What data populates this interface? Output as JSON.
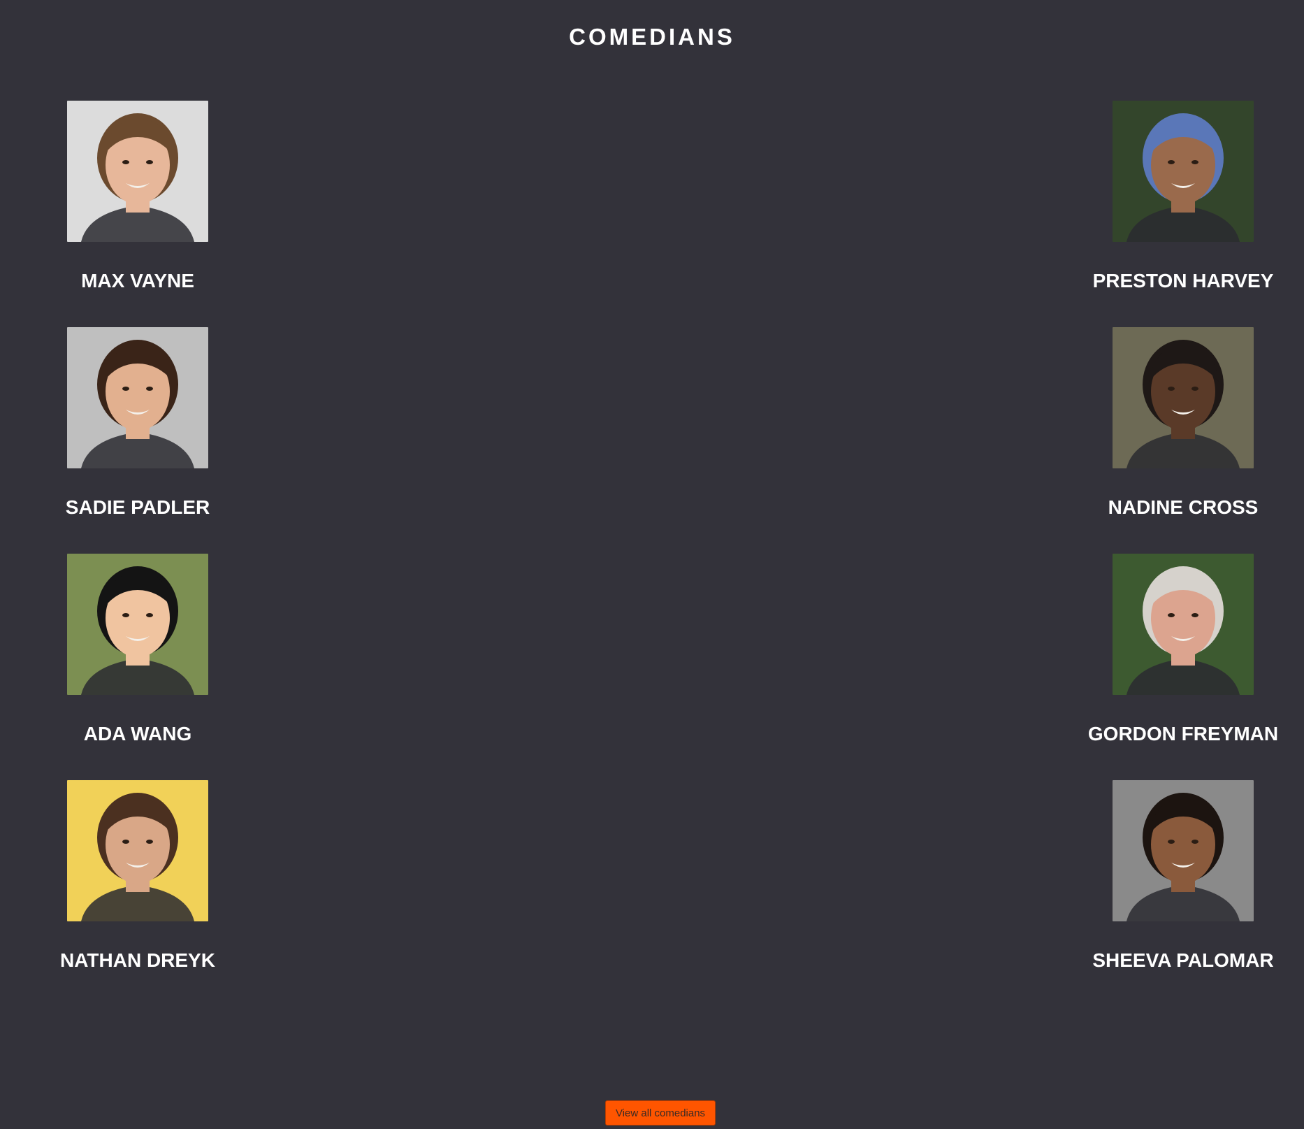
{
  "page": {
    "title": "COMEDIANS",
    "background": "#33323a"
  },
  "comedians_left": [
    {
      "name": "MAX VAYNE",
      "photo": "portrait-photo",
      "bg": "#dcdcdc",
      "skin": "#e7b79a",
      "hair": "#6b4a2e"
    },
    {
      "name": "SADIE PADLER",
      "photo": "portrait-photo",
      "bg": "#bfbfbf",
      "skin": "#e2b08f",
      "hair": "#3a2418"
    },
    {
      "name": "ADA WANG",
      "photo": "portrait-photo",
      "bg": "#7c8f52",
      "skin": "#f0c4a0",
      "hair": "#141414"
    },
    {
      "name": "NATHAN DREYK",
      "photo": "portrait-photo",
      "bg": "#f1d158",
      "skin": "#d9a787",
      "hair": "#4b3020"
    }
  ],
  "comedians_right": [
    {
      "name": "PRESTON HARVEY",
      "photo": "portrait-photo",
      "bg": "#33452b",
      "skin": "#9a6a4c",
      "hair": "#5a77b8"
    },
    {
      "name": "NADINE CROSS",
      "photo": "portrait-photo",
      "bg": "#6d6a55",
      "skin": "#5a3a28",
      "hair": "#1e1816"
    },
    {
      "name": "GORDON FREYMAN",
      "photo": "portrait-photo",
      "bg": "#3d5a30",
      "skin": "#dca48f",
      "hair": "#d6d2cc"
    },
    {
      "name": "SHEEVA PALOMAR",
      "photo": "portrait-photo",
      "bg": "#8a8a8a",
      "skin": "#8a5a3c",
      "hair": "#1c1410"
    }
  ],
  "footer": {
    "view_all_label": "View all comedians",
    "accent": "#ff5500"
  }
}
